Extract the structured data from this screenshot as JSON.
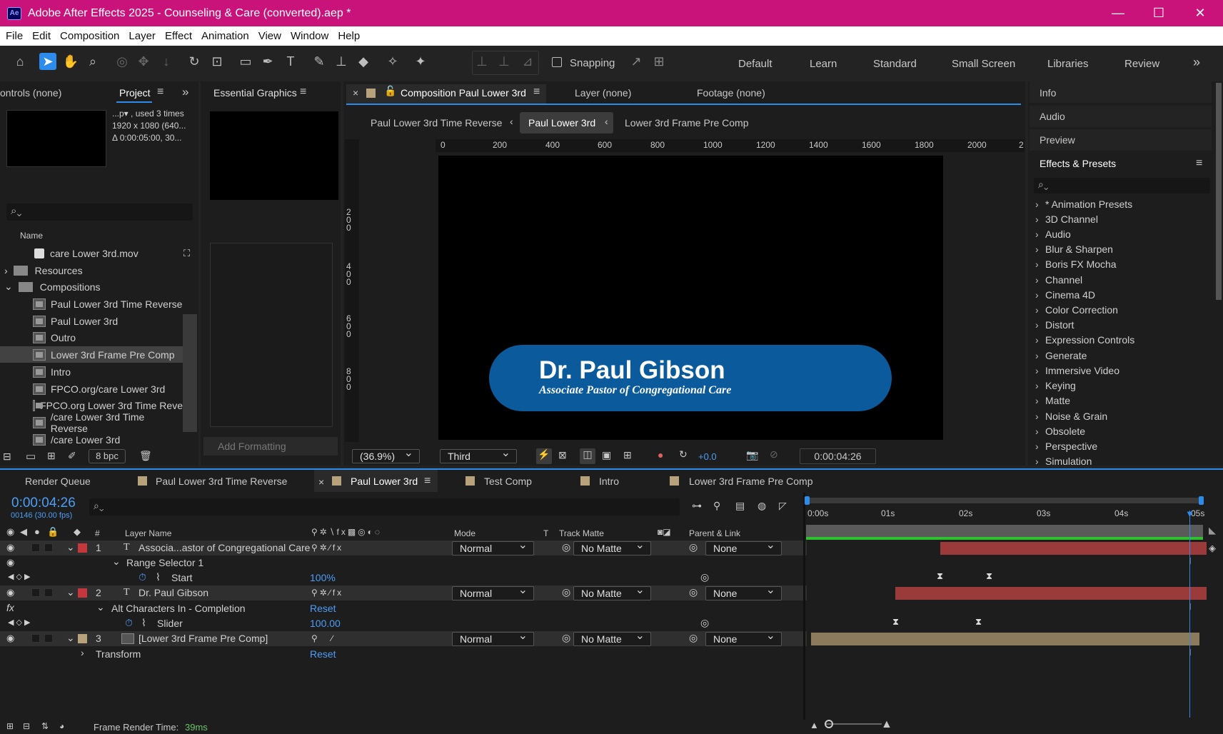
{
  "window": {
    "title": "Adobe After Effects 2025 - Counseling & Care (converted).aep *",
    "app_icon": "Ae"
  },
  "menu": [
    "File",
    "Edit",
    "Composition",
    "Layer",
    "Effect",
    "Animation",
    "View",
    "Window",
    "Help"
  ],
  "toolbar": {
    "snapping_label": "Snapping",
    "workspaces": [
      "Default",
      "Learn",
      "Standard",
      "Small Screen",
      "Libraries",
      "Review"
    ]
  },
  "left_panel": {
    "tabs": {
      "controls": "ontrols (none)",
      "project": "Project",
      "essential_graphics": "Essential Graphics"
    },
    "preview_info": [
      "...p▾ , used 3 times",
      "1920 x 1080  (640...",
      "Δ 0:00:05:00, 30..."
    ],
    "name_header": "Name",
    "items": [
      {
        "label": "care Lower 3rd.mov",
        "type": "footage"
      },
      {
        "label": "Resources",
        "type": "folder"
      },
      {
        "label": "Compositions",
        "type": "folder"
      },
      {
        "label": "Paul Lower 3rd Time Reverse",
        "type": "comp"
      },
      {
        "label": "Paul Lower 3rd",
        "type": "comp"
      },
      {
        "label": "Outro",
        "type": "comp"
      },
      {
        "label": "Lower 3rd Frame Pre Comp",
        "type": "comp"
      },
      {
        "label": "Intro",
        "type": "comp"
      },
      {
        "label": "FPCO.org/care Lower 3rd",
        "type": "comp"
      },
      {
        "label": "FPCO.org Lower 3rd Time Reve",
        "type": "comp"
      },
      {
        "label": "/care Lower 3rd Time Reverse",
        "type": "comp"
      },
      {
        "label": "/care Lower 3rd",
        "type": "comp"
      }
    ],
    "bpc": "8 bpc",
    "add_formatting": "Add Formatting"
  },
  "viewer": {
    "tabs": {
      "composition": "Composition Paul Lower 3rd",
      "layer": "Layer (none)",
      "footage": "Footage (none)"
    },
    "breadcrumb": [
      "Paul Lower 3rd Time Reverse",
      "Paul Lower 3rd",
      "Lower 3rd Frame Pre Comp"
    ],
    "ruler_h": [
      "0",
      "200",
      "400",
      "600",
      "800",
      "1000",
      "1200",
      "1400",
      "1600",
      "1800",
      "2000",
      "2"
    ],
    "ruler_v": [
      "2\n0\n0",
      "4\n0\n0",
      "6\n0\n0",
      "8\n0\n0"
    ],
    "lower_third": {
      "name": "Dr. Paul Gibson",
      "subtitle": "Associate Pastor of Congregational Care"
    },
    "zoom": "(36.9%)",
    "resolution": "Third",
    "exposure": "+0.0",
    "timecode": "0:00:04:26"
  },
  "right_panel": {
    "sections": [
      "Info",
      "Audio",
      "Preview",
      "Effects & Presets"
    ],
    "effects": [
      "* Animation Presets",
      "3D Channel",
      "Audio",
      "Blur & Sharpen",
      "Boris FX Mocha",
      "Channel",
      "Cinema 4D",
      "Color Correction",
      "Distort",
      "Expression Controls",
      "Generate",
      "Immersive Video",
      "Keying",
      "Matte",
      "Noise & Grain",
      "Obsolete",
      "Perspective",
      "Simulation"
    ]
  },
  "timeline": {
    "tabs": [
      "Render Queue",
      "Paul Lower 3rd Time Reverse",
      "Paul Lower 3rd",
      "Test Comp",
      "Intro",
      "Lower 3rd Frame Pre Comp"
    ],
    "timecode": "0:00:04:26",
    "frame_info": "00146 (30.00 fps)",
    "columns": {
      "num": "#",
      "layer_name": "Layer Name",
      "mode": "Mode",
      "t": "T",
      "track_matte": "Track Matte",
      "parent": "Parent & Link"
    },
    "time_labels": [
      "0:00s",
      "01s",
      "02s",
      "03s",
      "04s",
      "05s"
    ],
    "rows": [
      {
        "num": "1",
        "name": "Associa...astor of Congregational Care",
        "mode": "Normal",
        "matte": "No Matte",
        "parent": "None",
        "label_color": "#c4383d"
      },
      {
        "name": "Range Selector 1"
      },
      {
        "name": "Start",
        "value": "100%"
      },
      {
        "num": "2",
        "name": "Dr. Paul Gibson",
        "mode": "Normal",
        "matte": "No Matte",
        "parent": "None",
        "label_color": "#c4383d"
      },
      {
        "name": "Alt Characters In - Completion",
        "value": "Reset"
      },
      {
        "name": "Slider",
        "value": "100.00"
      },
      {
        "num": "3",
        "name": "[Lower 3rd Frame Pre Comp]",
        "mode": "Normal",
        "matte": "No Matte",
        "parent": "None",
        "label_color": "#b8a27c"
      },
      {
        "name": "Transform",
        "value": "Reset"
      }
    ],
    "status": {
      "label": "Frame Render Time:",
      "value": "39ms"
    }
  },
  "colors": {
    "titlebar": "#c9137a",
    "accent": "#2d8ceb",
    "bar_red": "#9a3a3a",
    "bar_tan": "#8c7a5c",
    "pill": "#0a5a9c"
  }
}
